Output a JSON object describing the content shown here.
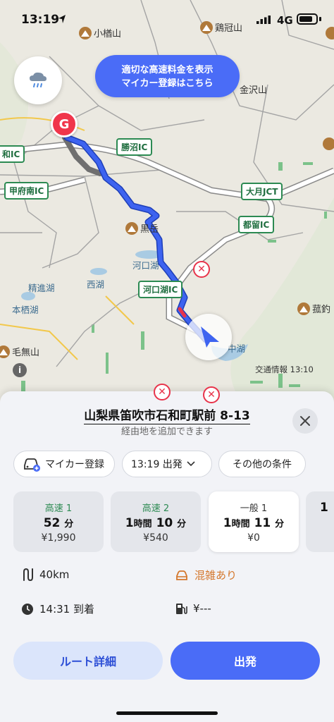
{
  "status_bar": {
    "time": "13:19",
    "network": "4G"
  },
  "map": {
    "promo_banner": {
      "line1": "適切な高速料金を表示",
      "line2": "マイカー登録はこちら"
    },
    "goal_pin": "G",
    "interchanges": {
      "katsunuma": "勝沼IC",
      "wa": "和IC",
      "kofu_minami": "甲府南IC",
      "otsuki": "大月JCT",
      "tsuru": "都留IC",
      "kawaguchiko": "河口湖IC"
    },
    "mountains": {
      "ogurayama": "小楢山",
      "keikanzan": "鶏冠山",
      "kanazawayama": "金沢山",
      "kurodake": "黒岳",
      "nakibutsu": "菰釣",
      "kenashi": "毛無山"
    },
    "places": {
      "kawaguchiko": "河口湖",
      "shojiko": "精進湖",
      "saiko": "西湖",
      "motosuko": "本栖湖",
      "yamanakako": "中湖"
    },
    "traffic_info": "交通情報 13:10",
    "colors": {
      "route": "#3d63f0",
      "highway": "#2c8a52",
      "closure": "#e8334a"
    }
  },
  "sheet": {
    "destination": "山梨県笛吹市石和町駅前 8-13",
    "add_waypoint": "経由地を追加できます",
    "chips": {
      "my_car": "マイカー登録",
      "departure": "13:19 出発",
      "other": "その他の条件"
    },
    "routes": [
      {
        "type": "高速 1",
        "time_main": "52",
        "time_unit": "分",
        "time_hours": "",
        "time_hours_unit": "",
        "fee": "¥1,990"
      },
      {
        "type": "高速 2",
        "time_hours": "1",
        "time_hours_unit": "時間",
        "time_main": "10",
        "time_unit": "分",
        "fee": "¥540"
      },
      {
        "type": "一般 1",
        "time_hours": "1",
        "time_hours_unit": "時間",
        "time_main": "11",
        "time_unit": "分",
        "fee": "¥0"
      },
      {
        "type": "",
        "time_hours": "1",
        "time_hours_unit": "",
        "time_main": "",
        "time_unit": "",
        "fee": ""
      }
    ],
    "distance": "40km",
    "congestion": "混雑あり",
    "arrival": "14:31 到着",
    "fuel_cost": "¥---",
    "buttons": {
      "detail": "ルート詳細",
      "start": "出発"
    }
  }
}
